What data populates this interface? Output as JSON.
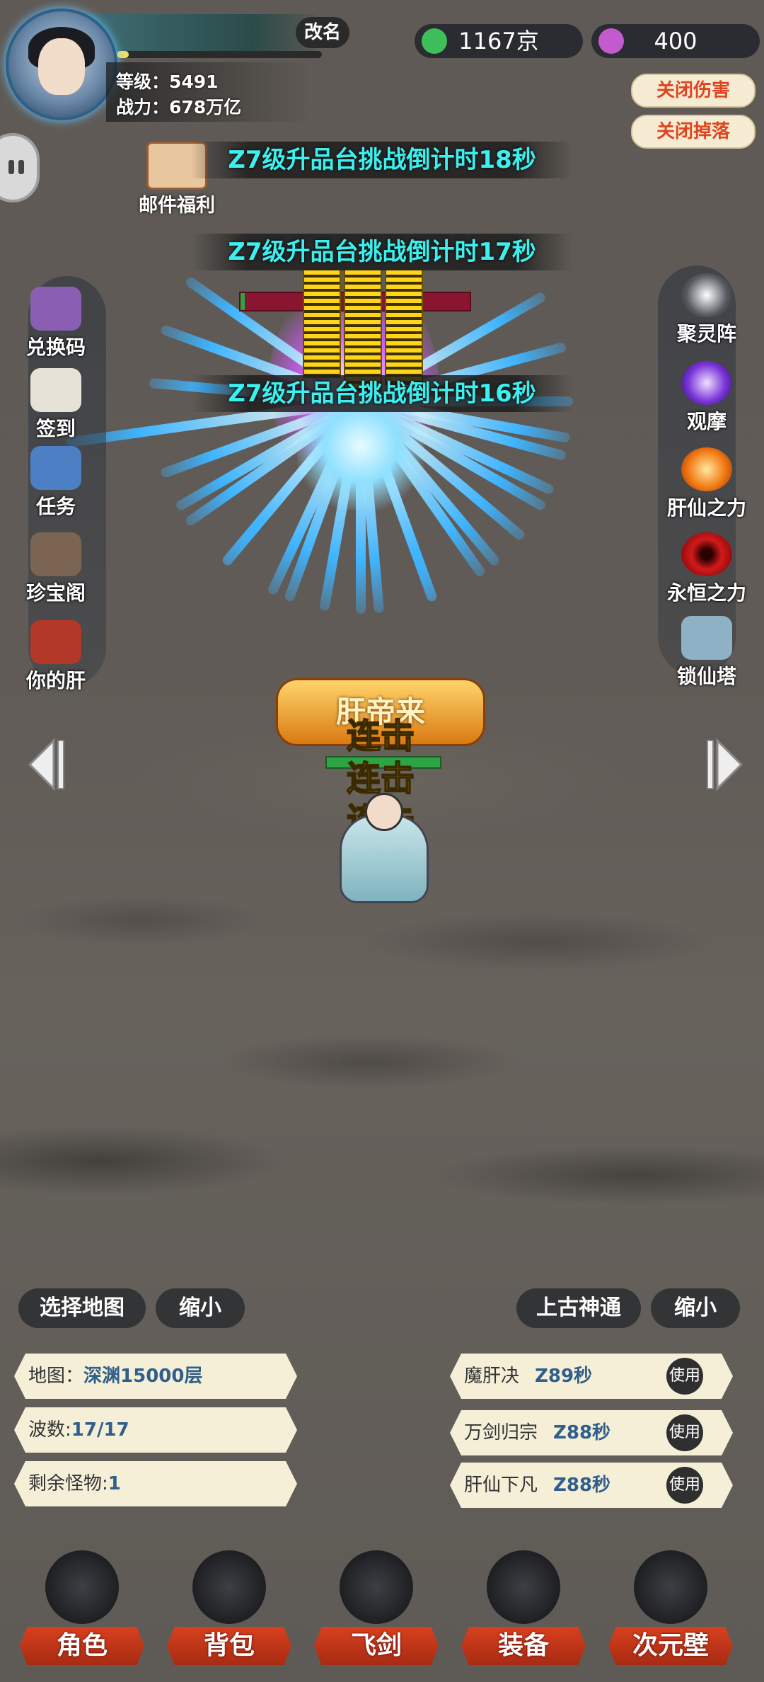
{
  "player": {
    "rename_label": "改名",
    "level_text": "等级：5491",
    "power_text": "战力：678万亿",
    "xp_progress": 0.06
  },
  "currency": {
    "gems": "1167京",
    "orbs": "400",
    "gem_color": "#3fbf5a",
    "orb_color": "#c45ad0"
  },
  "toggles": {
    "damage": "关闭伤害",
    "drops": "关闭掉落"
  },
  "mail_label": "邮件福利",
  "banners": [
    "Z7级升品台挑战倒计时18秒",
    "Z7级升品台挑战倒计时17秒",
    "Z7级升品台挑战倒计时16秒"
  ],
  "left_menu": [
    {
      "label": "兑换码",
      "icon": "treasure-chest-icon"
    },
    {
      "label": "签到",
      "icon": "scroll-icon"
    },
    {
      "label": "任务",
      "icon": "quest-scroll-icon"
    },
    {
      "label": "珍宝阁",
      "icon": "pavilion-icon"
    },
    {
      "label": "你的肝",
      "icon": "liver-icon"
    }
  ],
  "right_menu": [
    {
      "label": "聚灵阵",
      "icon": "spirit-array-icon"
    },
    {
      "label": "观摩",
      "icon": "purple-orb-icon"
    },
    {
      "label": "肝仙之力",
      "icon": "fire-orb-icon"
    },
    {
      "label": "永恒之力",
      "icon": "red-eye-orb-icon"
    },
    {
      "label": "锁仙塔",
      "icon": "tower-icon"
    }
  ],
  "battle": {
    "boss_hp": 0.02,
    "hero_title": "肝帝来",
    "combo_text": [
      "连击",
      "连击",
      "连击"
    ],
    "hero_hp": 1.0
  },
  "controls": {
    "select_map": "选择地图",
    "shrink_left": "缩小",
    "ancient_power": "上古神通",
    "shrink_right": "缩小"
  },
  "info": {
    "map_label": "地图：",
    "map_value": "深渊15000层",
    "wave_label": "波数:",
    "wave_value": "17/17",
    "remain_label": "剩余怪物:",
    "remain_value": "1"
  },
  "skills": [
    {
      "name": "魔肝决",
      "time": "Z89秒",
      "use": "使用"
    },
    {
      "name": "万剑归宗",
      "time": "Z88秒",
      "use": "使用"
    },
    {
      "name": "肝仙下凡",
      "time": "Z88秒",
      "use": "使用"
    }
  ],
  "bottom_nav": [
    {
      "label": "角色",
      "icon": "character-icon"
    },
    {
      "label": "背包",
      "icon": "bag-icon"
    },
    {
      "label": "飞剑",
      "icon": "flying-sword-icon"
    },
    {
      "label": "装备",
      "icon": "dragon-equipment-icon"
    },
    {
      "label": "次元壁",
      "icon": "dimension-wall-icon"
    }
  ]
}
